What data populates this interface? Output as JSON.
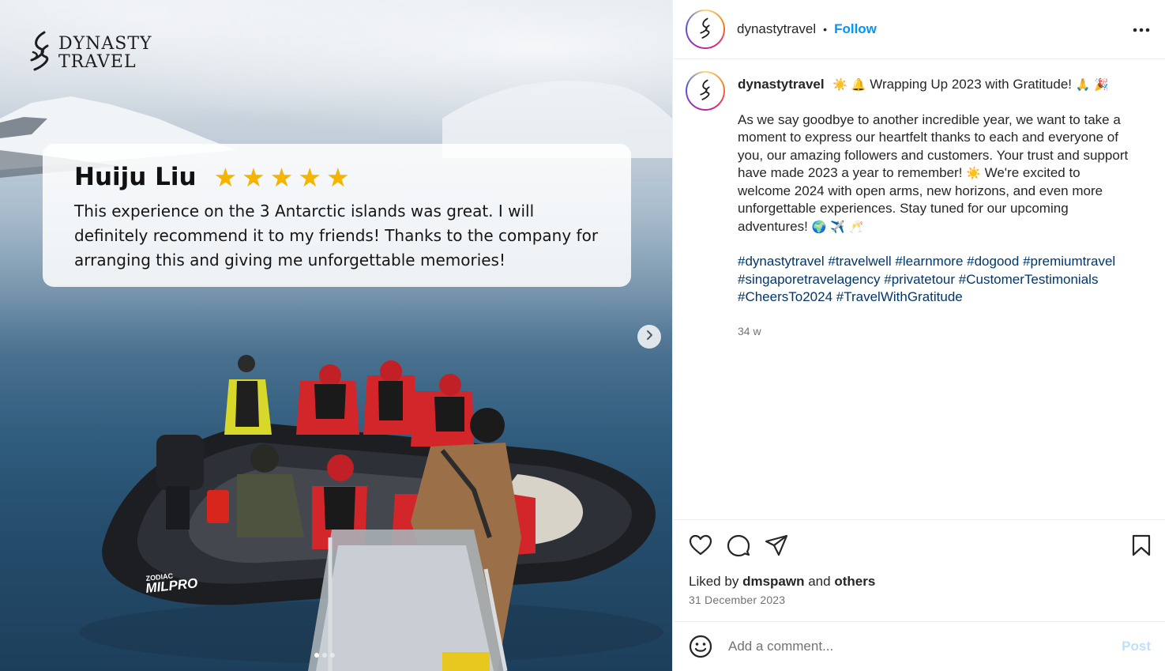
{
  "media": {
    "logo_line1": "DYNASTY",
    "logo_line2": "TRAVEL",
    "review": {
      "name": "Huiju Liu",
      "rating": 5,
      "text_line1": "This experience on the 3 Antarctic islands was great. I will",
      "text_line2": "definitely recommend it to my friends! Thanks to the company for",
      "text_line3": "arranging this and giving me unforgettable memories!"
    },
    "boat_brand_line1": "ZODIAC",
    "boat_brand_line2": "MILPRO",
    "carousel_dots": 3,
    "active_dot": 0
  },
  "post": {
    "header": {
      "username": "dynastytravel",
      "separator": "•",
      "follow_label": "Follow"
    },
    "caption": {
      "username": "dynastytravel",
      "title": "Wrapping Up 2023 with Gratitude!",
      "title_emoji_before": "☀️ 🔔",
      "title_emoji_after": "🙏 🎉",
      "body_part1": "As we say goodbye to another incredible year, we want to take a moment to express our heartfelt thanks to each and everyone of you, our amazing followers and customers. Your trust and support have made 2023 a year to remember!",
      "body_emoji1": "☀️",
      "body_part2": "We're excited to welcome 2024 with open arms, new horizons, and even more unforgettable experiences. Stay tuned for our upcoming adventures!",
      "body_emoji2": "🌍 ✈️ 🥂",
      "hashtags": [
        "#dynastytravel",
        "#travelwell",
        "#learnmore",
        "#dogood",
        "#premiumtravel",
        "#singaporetravelagency",
        "#privatetour",
        "#CustomerTestimonials",
        "#CheersTo2024",
        "#TravelWithGratitude"
      ],
      "time_ago": "34 w"
    },
    "likes": {
      "prefix": "Liked by",
      "user": "dmspawn",
      "conjunction": "and",
      "others": "others"
    },
    "date": "31 December 2023",
    "comment": {
      "placeholder": "Add a comment...",
      "post_label": "Post"
    }
  },
  "icons": {
    "like": "heart-icon",
    "comment": "comment-icon",
    "share": "share-icon",
    "save": "bookmark-icon",
    "emoji": "smile-icon",
    "more": "more-icon",
    "next": "chevron-right-icon"
  },
  "colors": {
    "follow": "#0095f6",
    "hashtag": "#00376b",
    "star": "#f5b400",
    "post_disabled": "#c0dffd"
  }
}
